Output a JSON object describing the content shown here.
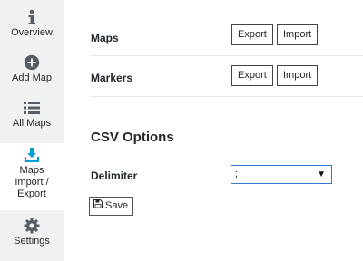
{
  "sidebar": {
    "items": [
      {
        "label": "Overview",
        "icon": "info-icon"
      },
      {
        "label": "Add Map",
        "icon": "plus-circle-icon"
      },
      {
        "label": "All Maps",
        "icon": "list-icon"
      },
      {
        "label": "Maps Import / Export",
        "icon": "download-icon",
        "active": true
      },
      {
        "label": "Settings",
        "icon": "gear-icon"
      }
    ]
  },
  "main": {
    "rows": [
      {
        "label": "Maps",
        "export_label": "Export",
        "import_label": "Import"
      },
      {
        "label": "Markers",
        "export_label": "Export",
        "import_label": "Import"
      }
    ],
    "csv": {
      "title": "CSV Options",
      "delimiter_label": "Delimiter",
      "delimiter_value": ";",
      "save_label": "Save"
    }
  },
  "colors": {
    "sidebar_bg": "#f1f1f1",
    "icon_dark": "#555d66",
    "active_icon": "#00a0d2",
    "select_border": "#2e7bd1"
  }
}
